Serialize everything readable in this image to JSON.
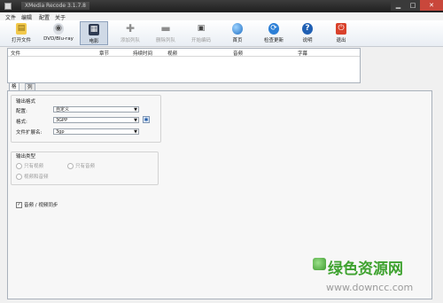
{
  "window": {
    "title": "XMedia Recode 3.1.7.8"
  },
  "menu": [
    "文件",
    "编辑",
    "配置",
    "关于"
  ],
  "toolbar": [
    {
      "label": "打开文件",
      "icon": "folder-icon",
      "state": "normal"
    },
    {
      "label": "DVD/Blu-ray",
      "icon": "disc-icon",
      "state": "normal"
    },
    {
      "label": "电影",
      "icon": "film-icon",
      "state": "active"
    },
    {
      "label": "添加列队",
      "icon": "plus-icon",
      "state": "disabled"
    },
    {
      "label": "删除列队",
      "icon": "minus-icon",
      "state": "disabled"
    },
    {
      "label": "开始编码",
      "icon": "encode-icon",
      "state": "disabled"
    },
    {
      "label": "首页",
      "icon": "globe-icon",
      "state": "normal"
    },
    {
      "label": "检查更新",
      "icon": "refresh-icon",
      "state": "normal"
    },
    {
      "label": "说明",
      "icon": "help-icon",
      "state": "normal"
    },
    {
      "label": "退出",
      "icon": "power-icon",
      "state": "normal"
    }
  ],
  "queue_table": {
    "columns": [
      "文件",
      "章节",
      "持续时间",
      "视频",
      "音频",
      "字幕"
    ]
  },
  "tabs": [
    "格式",
    "列队"
  ],
  "format_panel": {
    "output_format": {
      "title": "输出格式",
      "profile_label": "配置:",
      "profile_value": "自定义",
      "format_label": "格式:",
      "format_value": "3GPP",
      "ext_label": "文件扩展名:",
      "ext_value": "3gp"
    },
    "output_type": {
      "title": "输出类型",
      "options": [
        "只有视频",
        "只有音频",
        "视频和音频"
      ]
    },
    "av_sync": {
      "label": "音频 / 视频同步",
      "checked": true
    }
  },
  "watermark": {
    "brand": "绿色资源网",
    "url": "www.downcc.com"
  },
  "colors": {
    "accent_active": "#cfd9e6",
    "title_bar": "#2a2a2a",
    "close": "#c9473b",
    "watermark": "#3ea22f"
  }
}
